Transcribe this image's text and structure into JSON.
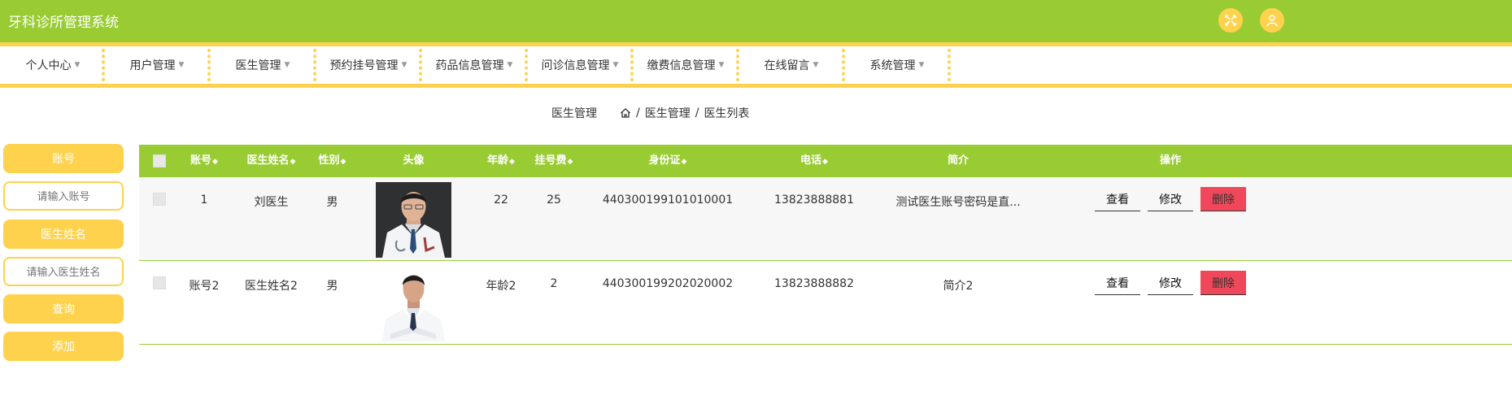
{
  "app": {
    "title": "牙科诊所管理系统"
  },
  "header_icons": [
    "expand-icon",
    "user-icon"
  ],
  "colors": {
    "primary_green": "#99cc33",
    "accent_yellow": "#ffd24d",
    "delete_red": "#f0485a"
  },
  "nav": {
    "items": [
      {
        "label": "个人中心"
      },
      {
        "label": "用户管理"
      },
      {
        "label": "医生管理"
      },
      {
        "label": "预约挂号管理"
      },
      {
        "label": "药品信息管理"
      },
      {
        "label": "问诊信息管理"
      },
      {
        "label": "缴费信息管理"
      },
      {
        "label": "在线留言"
      },
      {
        "label": "系统管理"
      }
    ]
  },
  "breadcrumb": {
    "title": "医生管理",
    "path1": "医生管理",
    "path2": "医生列表",
    "sep": "/"
  },
  "search": {
    "account_label": "账号",
    "account_placeholder": "请输入账号",
    "name_label": "医生姓名",
    "name_placeholder": "请输入医生姓名",
    "query_label": "查询",
    "add_label": "添加"
  },
  "table": {
    "headers": {
      "account": "账号",
      "name": "医生姓名",
      "gender": "性别",
      "avatar": "头像",
      "age": "年龄",
      "fee": "挂号费",
      "id_card": "身份证",
      "phone": "电话",
      "intro": "简介",
      "actions": "操作"
    },
    "rows": [
      {
        "account": "1",
        "name": "刘医生",
        "gender": "男",
        "age": "22",
        "fee": "25",
        "id_card": "440300199101010001",
        "phone": "13823888881",
        "intro": "测试医生账号密码是直..."
      },
      {
        "account": "账号2",
        "name": "医生姓名2",
        "gender": "男",
        "age": "年龄2",
        "fee": "2",
        "id_card": "440300199202020002",
        "phone": "13823888882",
        "intro": "简介2"
      }
    ],
    "actions": {
      "view": "查看",
      "edit": "修改",
      "delete": "删除"
    }
  }
}
